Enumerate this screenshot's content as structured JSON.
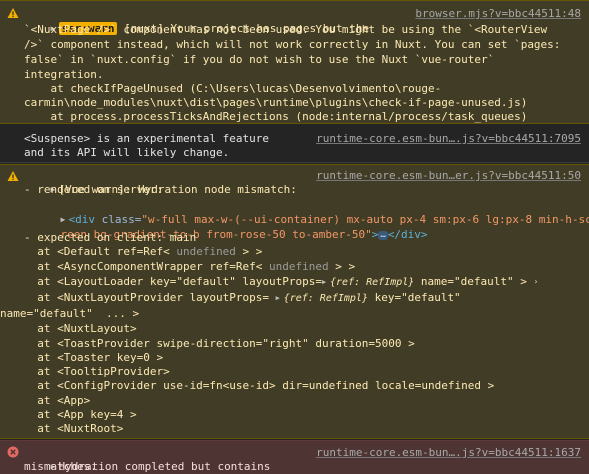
{
  "messages": [
    {
      "kind": "warn",
      "link": "browser.mjs?v=bbc44511:48",
      "badge": "ssr:warn",
      "lines": [
        "[nuxt] Your project has pages but the",
        "`<NuxtPage />` component has not been used. You might be using the `<RouterView",
        "/>` component instead, which will not work correctly in Nuxt. You can set `pages:",
        "false` in `nuxt.config` if you do not wish to use the Nuxt `vue-router`",
        "integration.",
        "    at checkIfPageUnused (C:\\Users\\lucas\\Desenvolvimento\\rouge-",
        "carmin\\node_modules\\nuxt\\dist\\pages\\runtime\\plugins\\check-if-page-unused.js)",
        "    at process.processTicksAndRejections (node:internal/process/task_queues)"
      ]
    },
    {
      "kind": "info",
      "link": "runtime-core.esm-bun….js?v=bbc44511:7095",
      "lines": [
        "<Suspense> is an experimental feature",
        "and its API will likely change."
      ]
    },
    {
      "kind": "warn",
      "link": "runtime-core.esm-bun…er.js?v=bbc44511:50",
      "first": "[Vue warn]: Hydration node mismatch:",
      "rendered_label": "- rendered on server:",
      "server_tag_open": "<div",
      "server_attr_name": "class",
      "server_attr_value_1": "\"w-full max-w-(--ui-container) mx-auto px-4 sm:px-6 lg:px-8 min-h-sc",
      "server_attr_value_2": "reen bg-gradient-to-b from-rose-50 to-amber-50\"",
      "server_ellipsis": "…",
      "server_tag_close": "</div>",
      "expected_label": "- expected on client: main",
      "undefined_text": "undefined",
      "ref_label": "{ref: RefImpl}",
      "l_default": "  at <Default ref=Ref< ",
      "l_default_end": " > >",
      "l_async": "  at <AsyncComponentWrapper ref=Ref< ",
      "l_async_end": " > >",
      "l_layoutloader": "  at <LayoutLoader key=\"default\" layoutProps=",
      "l_layoutloader_end": " name=\"default\" >",
      "l_provider": "  at <NuxtLayoutProvider layoutProps=",
      "l_provider_end": " key=\"default\"",
      "l_name_default": "name=\"default\"  ... >",
      "rest": [
        "  at <NuxtLayout>",
        "  at <ToastProvider swipe-direction=\"right\" duration=5000 >",
        "  at <Toaster key=0 >",
        "  at <TooltipProvider>",
        "  at <ConfigProvider use-id=fn<use-id> dir=undefined locale=undefined >",
        "  at <App>",
        "  at <App key=4 >",
        "  at <NuxtRoot>"
      ]
    },
    {
      "kind": "error",
      "link": "runtime-core.esm-bun….js?v=bbc44511:1637",
      "lines": [
        "Hydration completed but contains",
        "mismatches."
      ]
    }
  ],
  "colors": {
    "warn_bg": "#413c26",
    "error_bg": "#4e3534",
    "badge": "#f4b000",
    "tag": "#5db0d7",
    "attr_value": "#f29766"
  }
}
